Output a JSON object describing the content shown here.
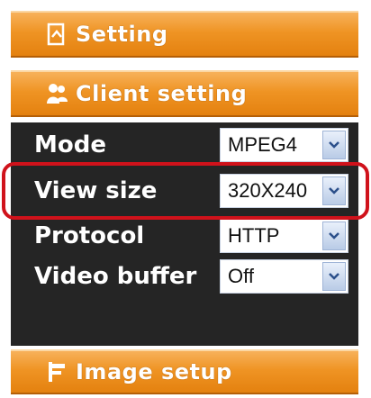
{
  "setting_bar": {
    "label": "Setting",
    "icon": "document-icon"
  },
  "client_bar": {
    "label": "Client setting",
    "icon": "users-icon"
  },
  "image_bar": {
    "label": "Image setup",
    "icon": "image-setup-icon"
  },
  "rows": [
    {
      "label": "Mode",
      "value": "MPEG4"
    },
    {
      "label": "View size",
      "value": "320X240"
    },
    {
      "label": "Protocol",
      "value": "HTTP"
    },
    {
      "label": "Video buffer",
      "value": "Off"
    }
  ],
  "colors": {
    "bar": "#ef9424",
    "panel": "#252525",
    "highlight": "#d0121b"
  }
}
